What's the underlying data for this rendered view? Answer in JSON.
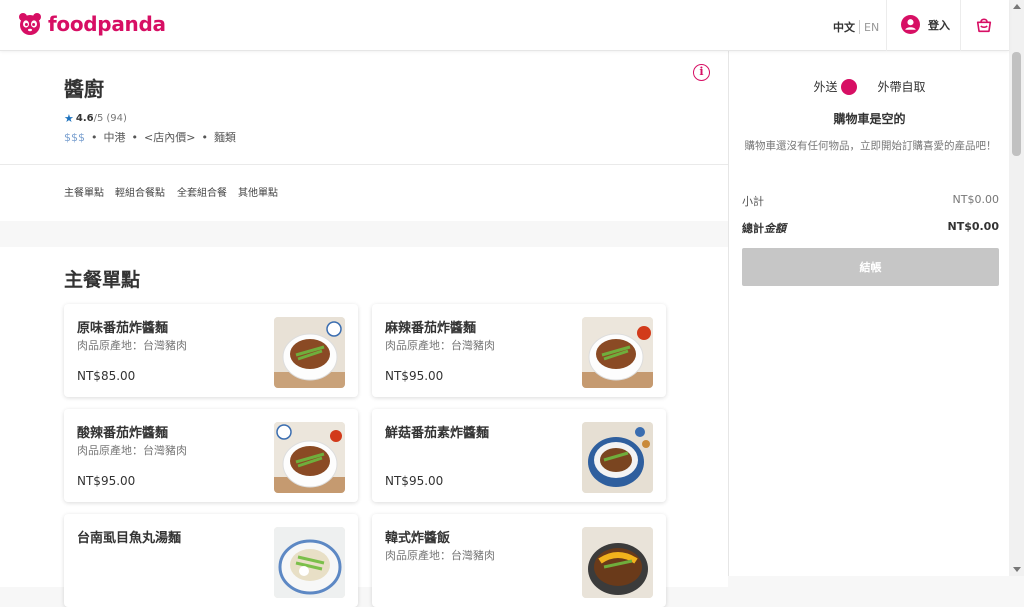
{
  "header": {
    "brand": "foodpanda",
    "lang_zh": "中文",
    "lang_en": "EN",
    "login_label": "登入",
    "brand_color": "#d70f64"
  },
  "vendor": {
    "name": "醬廚",
    "rating_score": "4.6",
    "rating_scale": "/5",
    "rating_count": "(94)",
    "tags": [
      "$$$",
      "中港",
      "<店內價>",
      "麵類"
    ]
  },
  "tabs": [
    "主餐單點",
    "輕組合餐點",
    "全套組合餐",
    "其他單點"
  ],
  "section": {
    "title": "主餐單點",
    "items": [
      {
        "name": "原味番茄炸醬麵",
        "desc": "肉品原產地：台灣豬肉",
        "price": "NT$85.00",
        "thumb": "white-bowl"
      },
      {
        "name": "麻辣番茄炸醬麵",
        "desc": "肉品原產地：台灣豬肉",
        "price": "NT$95.00",
        "thumb": "white-bowl"
      },
      {
        "name": "酸辣番茄炸醬麵",
        "desc": "肉品原產地：台灣豬肉",
        "price": "NT$95.00",
        "thumb": "white-bowl"
      },
      {
        "name": "鮮菇番茄素炸醬麵",
        "desc": "",
        "price": "NT$95.00",
        "thumb": "blue-bowl"
      },
      {
        "name": "台南虱目魚丸湯麵",
        "desc": "",
        "price": "",
        "thumb": "soup-bowl"
      },
      {
        "name": "韓式炸醬飯",
        "desc": "肉品原產地：台灣豬肉",
        "price": "",
        "thumb": "rice-bowl"
      }
    ]
  },
  "cart": {
    "delivery_label": "外送",
    "pickup_label": "外帶自取",
    "title": "購物車是空的",
    "empty_message": "購物車還沒有任何物品，立即開始訂購喜愛的產品吧！",
    "subtotal_label": "小計",
    "subtotal_value": "NT$0.00",
    "total_label": "總計",
    "total_label_em": "金額",
    "total_value": "NT$0.00",
    "checkout_label": "結帳"
  }
}
